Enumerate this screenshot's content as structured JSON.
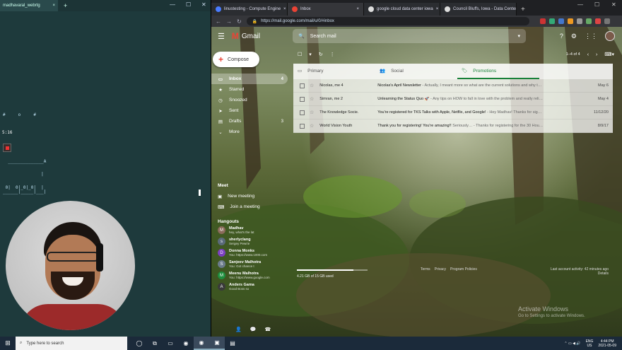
{
  "left_window": {
    "tab_label": "madhavaral_webrtg",
    "tab_close": "×",
    "new_tab": "+",
    "controls": {
      "min": "—",
      "max": "☐",
      "close": "✕"
    },
    "terminal": {
      "line_hashes": "#     o     #",
      "rec_time": "5:16",
      "ascii_wave_1": "  ______________A",
      "ascii_wave_2": "               |",
      "ascii_boxes": " 0|  0|_0|_0|  |",
      "ascii_base": "______|_____|___|"
    }
  },
  "chrome": {
    "tabs": [
      {
        "label": "linustesting - Compute Engine",
        "color": "#4a7cff"
      },
      {
        "label": "Inbox",
        "color": "#ea4335",
        "active": true
      },
      {
        "label": "google cloud data center iowa",
        "color": "#dddddd"
      },
      {
        "label": "Council Bluffs, Iowa - Data Center",
        "color": "#dddddd"
      }
    ],
    "tab_close": "×",
    "new_tab": "+",
    "controls": {
      "min": "—",
      "max": "☐",
      "close": "✕"
    },
    "nav": {
      "back": "←",
      "forward": "→",
      "reload": "↻"
    },
    "url": "https://mail.google.com/mail/u/0/#inbox",
    "lock": "🔒"
  },
  "gmail": {
    "menu_icon": "☰",
    "logo_m": "M",
    "logo_text": "Gmail",
    "search_placeholder": "Search mail",
    "search_icon": "🔍",
    "search_caret": "▾",
    "header_icons": {
      "help": "?",
      "settings": "⚙",
      "apps": "⋮⋮"
    },
    "compose": {
      "plus": "+",
      "label": "Compose"
    },
    "nav": [
      {
        "icon": "▭",
        "label": "Inbox",
        "count": "4",
        "active": true
      },
      {
        "icon": "★",
        "label": "Starred",
        "count": ""
      },
      {
        "icon": "◷",
        "label": "Snoozed",
        "count": ""
      },
      {
        "icon": "➤",
        "label": "Sent",
        "count": ""
      },
      {
        "icon": "▤",
        "label": "Drafts",
        "count": "3"
      },
      {
        "icon": "⌄",
        "label": "More",
        "count": ""
      }
    ],
    "meet": {
      "title": "Meet",
      "items": [
        {
          "icon": "▣",
          "label": "New meeting"
        },
        {
          "icon": "⌨",
          "label": "Join a meeting"
        }
      ]
    },
    "hangouts": {
      "title": "Hangouts",
      "contacts": [
        {
          "initial": "M",
          "name": "Madhav",
          "sub": "hey, what's the lat",
          "color": "#8a6a5a"
        },
        {
          "initial": "s",
          "name": "sherlyclang",
          "sub": "Sergey Pewrie",
          "color": "#5a6a7a"
        },
        {
          "initial": "D",
          "name": "Donna Monks",
          "sub": "You: https://www.1000.com",
          "color": "#7b3fbf"
        },
        {
          "initial": "S",
          "name": "Sanjeev Malhotra",
          "sub": "You: Got chance t",
          "color": "#6a7a8a"
        },
        {
          "initial": "M",
          "name": "Meenu Malhotra",
          "sub": "You: https://www.google.com",
          "color": "#1e8e3e"
        },
        {
          "initial": "A",
          "name": "Anders Gama",
          "sub": "Good Boss so",
          "color": "#3a3a3a"
        }
      ]
    },
    "hangouts_footer": {
      "person": "👤",
      "chat": "💬",
      "phone": "☎"
    },
    "toolbar": {
      "checkbox": "☐",
      "caret": "▾",
      "refresh": "↻",
      "more": "⋮",
      "count": "1–4 of 4",
      "prev": "‹",
      "next": "›",
      "keyboard": "⌨▾"
    },
    "categories": [
      {
        "icon": "▭",
        "label": "Primary"
      },
      {
        "icon": "👥",
        "label": "Social"
      },
      {
        "icon": "🏷",
        "label": "Promotions",
        "active": true
      }
    ],
    "emails": [
      {
        "from": "Nicolas, me 4",
        "subject": "Nicolas's April Newsletter",
        "snippet": " - Actually, I meant more so what are the current solutions and why t…",
        "date": "May 6"
      },
      {
        "from": "Simran, me 2",
        "subject": "Unlearning the Status Quo 🚀",
        "snippet": " - Any tips on HOW to fall in love with the problem and really reli…",
        "date": "May 4"
      },
      {
        "from": "The Knowledge Socie.",
        "subject": "You're registered for TKS Talks with Apple, Netflix, and Google!",
        "snippet": " - Hey Madhav! Thanks for sig…",
        "date": "11/12/20"
      },
      {
        "from": "World Vision Youth",
        "subject": "Thank you for registering! You're amazing!!",
        "snippet": " Seriously… - Thanks for registering for the 30 Hou…",
        "date": "8/9/17"
      }
    ],
    "storage": "4.21 GB of 15 GB used",
    "footer_links": [
      "Terms",
      "Privacy",
      "Program Policies"
    ],
    "last_activity": "Last account activity: 42 minutes ago",
    "details": "Details"
  },
  "activate_windows": {
    "title": "Activate Windows",
    "sub": "Go to Settings to activate Windows."
  },
  "taskbar": {
    "start": "⊞",
    "search_icon": "⌕",
    "search_placeholder": "Type here to search",
    "apps": [
      "◯",
      "⧉",
      "▭",
      "◉",
      "◉",
      "▣",
      "▤"
    ],
    "tray": {
      "lang": "ENG",
      "region": "US",
      "time": "4:44 PM",
      "date": "2021-05-09"
    }
  }
}
